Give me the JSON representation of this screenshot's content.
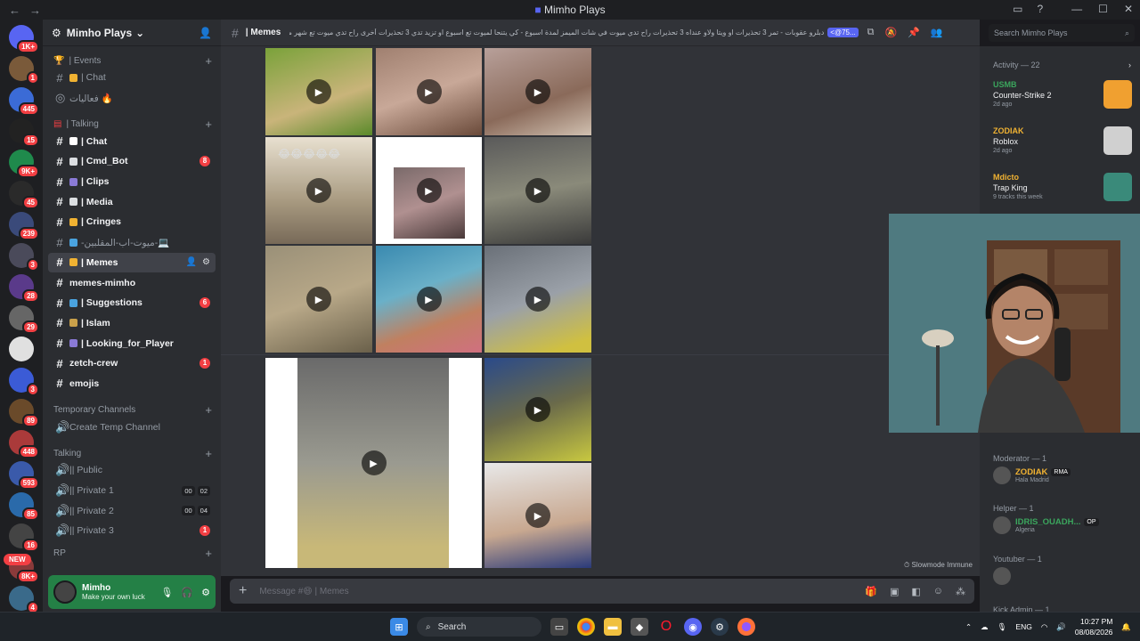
{
  "window": {
    "title": "Mimho Plays"
  },
  "servers": [
    {
      "badge": "1K+",
      "color": "#5865f2"
    },
    {
      "badge": "1",
      "color": "#7a5a3a"
    },
    {
      "badge": "445",
      "color": "#3b6bd6"
    },
    {
      "badge": "15",
      "color": "#222"
    },
    {
      "badge": "9K+",
      "color": "#1f8a4c"
    },
    {
      "badge": "45",
      "color": "#2a2a2a"
    },
    {
      "badge": "239",
      "color": "#3a4a7a"
    },
    {
      "badge": "3",
      "color": "#4a4a5a"
    },
    {
      "badge": "28",
      "color": "#5a3a8a"
    },
    {
      "badge": "29",
      "color": "#666"
    },
    {
      "badge": "",
      "color": "#e0e0e0"
    },
    {
      "badge": "3",
      "color": "#3b5bd6"
    },
    {
      "badge": "89",
      "color": "#6a4a2a"
    },
    {
      "badge": "448",
      "color": "#aa3a3a"
    },
    {
      "badge": "593",
      "color": "#3a5aaa"
    },
    {
      "badge": "85",
      "color": "#2a6aaa"
    },
    {
      "badge": "16",
      "color": "#444"
    },
    {
      "badge": "8K+",
      "color": "#8a3a3a"
    },
    {
      "badge": "4",
      "color": "#3a6a8a"
    }
  ],
  "servers_new": "NEW",
  "guild": {
    "name": "Mimho Plays"
  },
  "categories": {
    "events": "| Events",
    "talking": "| Talking",
    "temp": "Temporary Channels",
    "talking_voice": "Talking",
    "rp": "RP"
  },
  "channels_events": [
    {
      "name": "| Chat",
      "emo": "#f0b232"
    },
    {
      "name": "فعاليات 🔥",
      "emo": ""
    }
  ],
  "channels_talking": [
    {
      "name": "| Chat",
      "emo": "#ffffff",
      "badge": "",
      "bright": true
    },
    {
      "name": "| Cmd_Bot",
      "emo": "#dbdee1",
      "badge": "8",
      "bright": true
    },
    {
      "name": "| Clips",
      "emo": "#8a7ad6",
      "badge": "",
      "bright": true
    },
    {
      "name": "| Media",
      "emo": "#dbdee1",
      "badge": "",
      "bright": true
    },
    {
      "name": "| Cringes",
      "emo": "#f0b232",
      "badge": "",
      "bright": true
    },
    {
      "name": "-ميوت-اب-المقلبين-💻",
      "emo": "#4aa3df",
      "badge": "",
      "bright": false
    },
    {
      "name": "| Memes",
      "emo": "#f0b232",
      "badge": "",
      "bright": true,
      "active": true
    },
    {
      "name": "memes-mimho",
      "emo": "",
      "badge": "",
      "bright": true
    },
    {
      "name": "| Suggestions",
      "emo": "#4aa3df",
      "badge": "6",
      "bright": true
    },
    {
      "name": "| Islam",
      "emo": "#c9a04a",
      "badge": "",
      "bright": true
    },
    {
      "name": "| Looking_for_Player",
      "emo": "#8a7ad6",
      "badge": "",
      "bright": true
    },
    {
      "name": "zetch-crew",
      "emo": "",
      "badge": "1",
      "bright": true
    },
    {
      "name": "emojis",
      "emo": "",
      "badge": "",
      "bright": true
    }
  ],
  "temp_create": "Create Temp Channel",
  "voice_channels": [
    {
      "name": "|| Public",
      "counts": [],
      "badge": ""
    },
    {
      "name": "|| Private 1",
      "counts": [
        "00",
        "02"
      ],
      "badge": ""
    },
    {
      "name": "|| Private 2",
      "counts": [
        "00",
        "04"
      ],
      "badge": ""
    },
    {
      "name": "|| Private 3",
      "counts": [],
      "badge": "1"
    }
  ],
  "user": {
    "name": "Mimho",
    "status": "Make your own luck"
  },
  "header": {
    "channel": "| Memes",
    "topic": "دبلرو عقوبات - تمر 3 تحذيرات او ويتا ولاو عنداه 3 تحذيرات راح تدي ميوت في شات الميمز لمدة اسبوع - كي يتنحا لميوت تع اسبوع او تزيد تدي 3 تحذيرات أخرى راح تدي ميوت تع شهر من شات الميمز (",
    "mention": "<@75..."
  },
  "search": {
    "placeholder": "Search Mimho Plays"
  },
  "composer": {
    "placeholder": "Message #😄 | Memes"
  },
  "slowmode": "Slowmode Immune",
  "activity": {
    "title": "Activity — 22",
    "items": [
      {
        "user": "USMB",
        "user_color": "#3ba55d",
        "game": "Counter-Strike 2",
        "time": "2d ago",
        "thumb": "#f0a030"
      },
      {
        "user": "ZODIAK",
        "user_color": "#f0b232",
        "game": "Roblox",
        "time": "2d ago",
        "thumb": "#d0d0d0"
      },
      {
        "user": "Mdicto",
        "user_color": "#f0b232",
        "game": "Trap King",
        "time": "9 tracks this week",
        "thumb": "#3a8a7a"
      }
    ]
  },
  "roles": [
    {
      "name": "Moderator — 1",
      "member": "ZODIAK",
      "member_color": "#f0b232",
      "tag": "RMA",
      "status": "Hala Madrid"
    },
    {
      "name": "Helper — 1",
      "member": "IDRIS_OUADH...",
      "member_color": "#3ba55d",
      "tag": "OP",
      "status": "Algeria"
    },
    {
      "name": "Youtuber — 1",
      "member": "",
      "member_color": "#f23f43",
      "tag": "",
      "status": ""
    },
    {
      "name": "Kick Admin — 1",
      "member": "",
      "member_color": "",
      "tag": "",
      "status": ""
    }
  ],
  "taskbar": {
    "search": "Search",
    "lang": "ENG",
    "time": "10:27 PM",
    "date": "08/08/2026"
  }
}
